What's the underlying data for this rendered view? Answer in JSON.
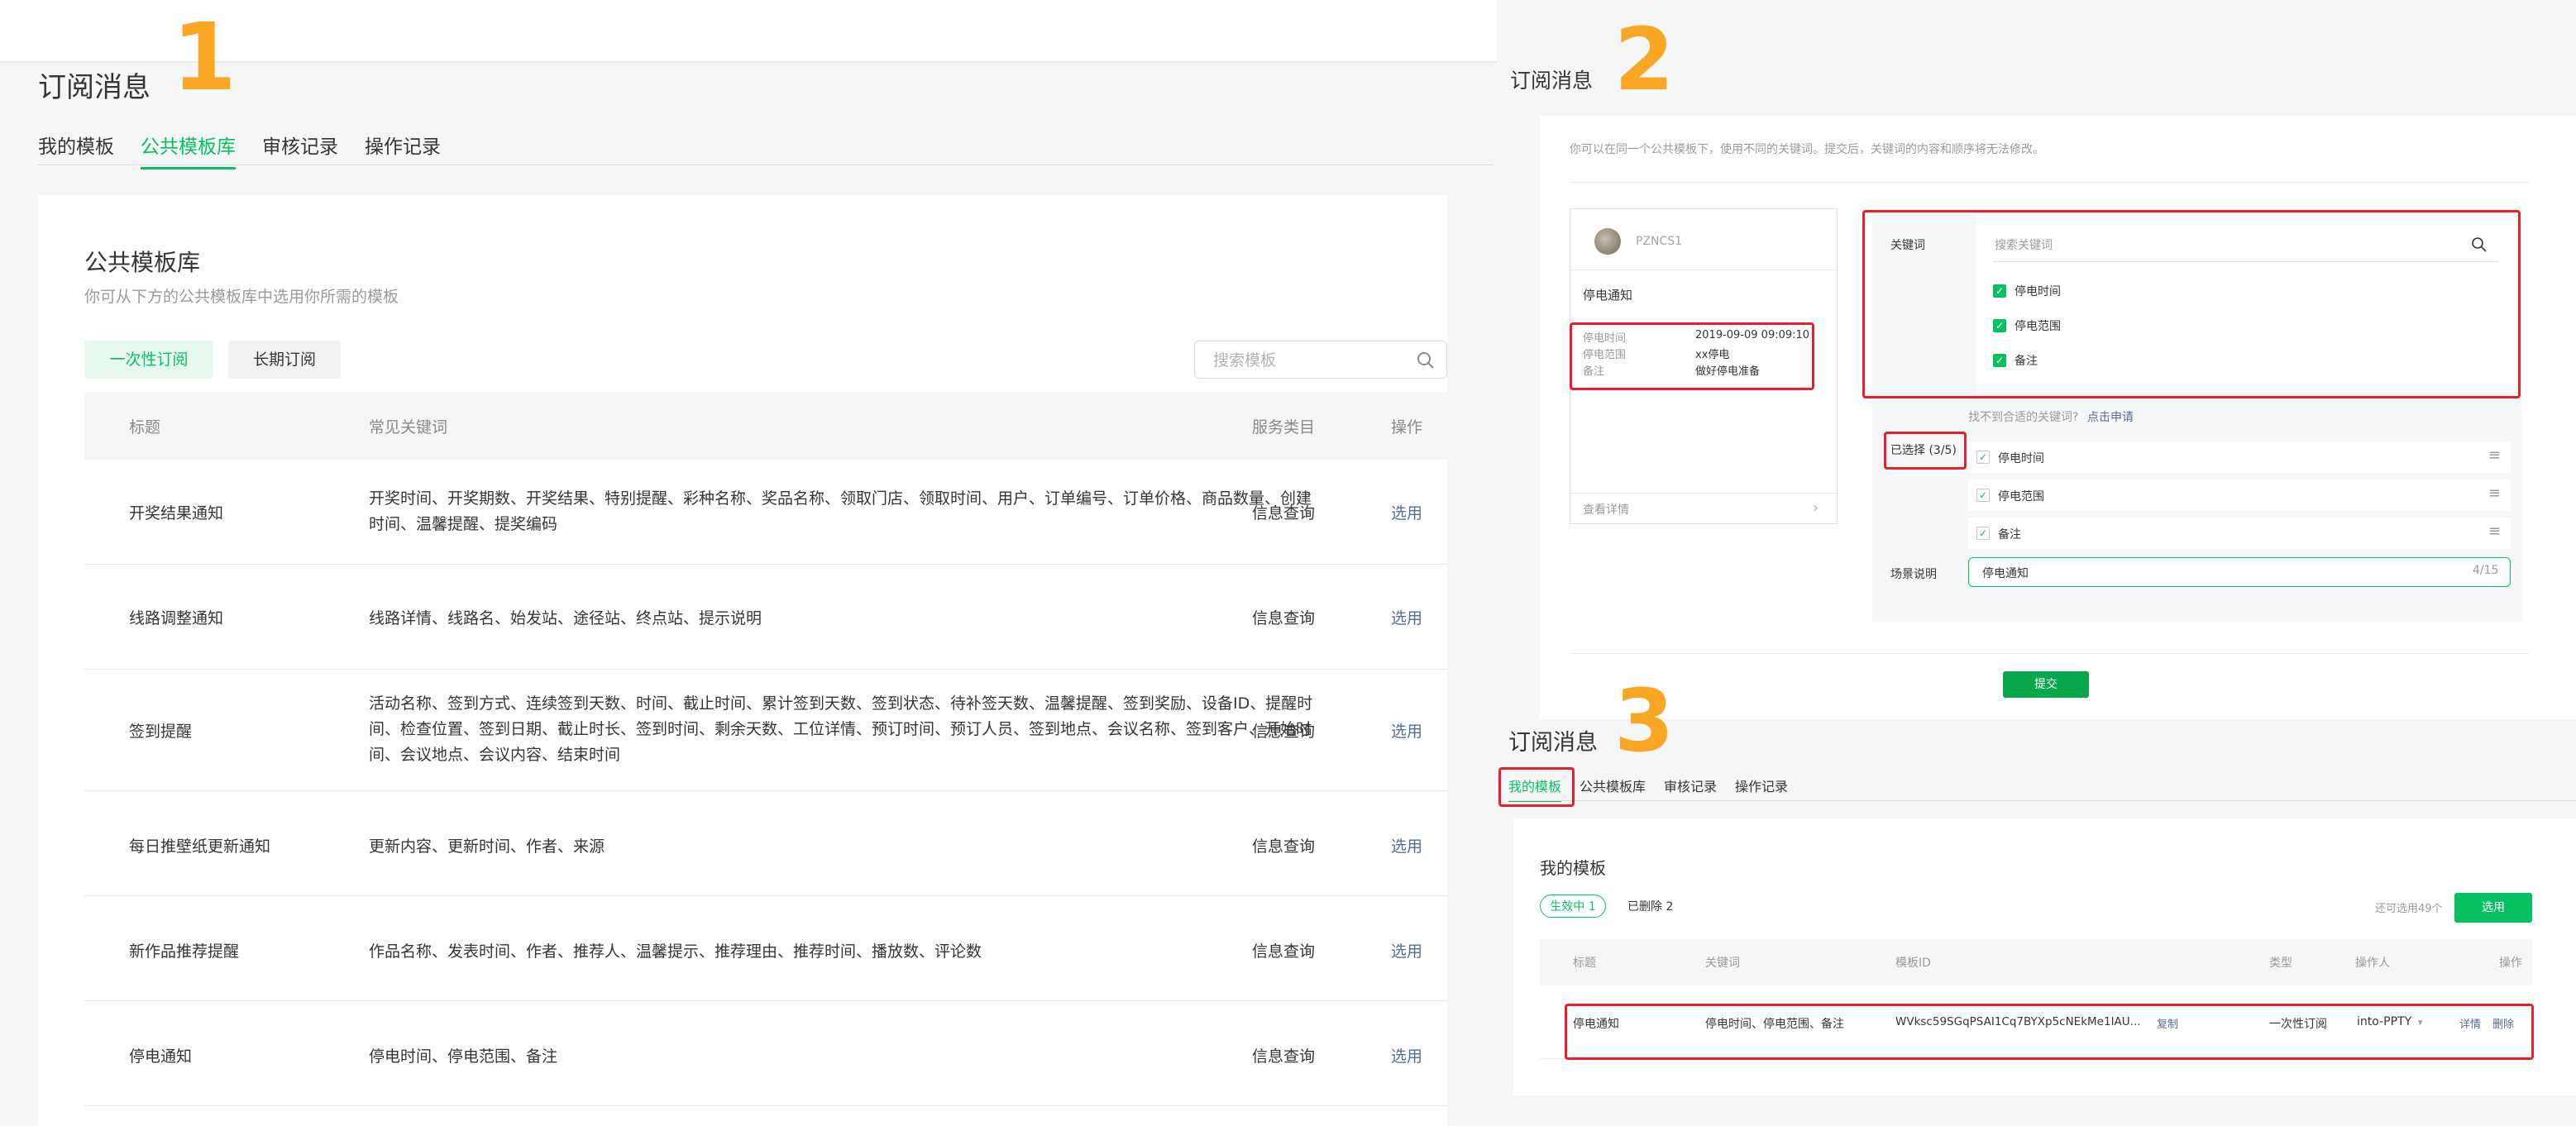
{
  "markers": [
    "1",
    "2",
    "3"
  ],
  "panel1": {
    "title": "订阅消息",
    "tabs": [
      "我的模板",
      "公共模板库",
      "审核记录",
      "操作记录"
    ],
    "library_title": "公共模板库",
    "library_subtitle": "你可从下方的公共模板库中选用你所需的模板",
    "filters": [
      "一次性订阅",
      "长期订阅"
    ],
    "search_placeholder": "搜索模板",
    "columns": [
      "标题",
      "常见关键词",
      "服务类目",
      "操作"
    ],
    "rows": [
      {
        "title": "开奖结果通知",
        "keywords": "开奖时间、开奖期数、开奖结果、特别提醒、彩种名称、奖品名称、领取门店、领取时间、用户、订单编号、订单价格、商品数量、创建时间、温馨提醒、提奖编码",
        "category": "信息查询",
        "action": "选用"
      },
      {
        "title": "线路调整通知",
        "keywords": "线路详情、线路名、始发站、途径站、终点站、提示说明",
        "category": "信息查询",
        "action": "选用"
      },
      {
        "title": "签到提醒",
        "keywords": "活动名称、签到方式、连续签到天数、时间、截止时间、累计签到天数、签到状态、待补签天数、温馨提醒、签到奖励、设备ID、提醒时间、检查位置、签到日期、截止时长、签到时间、剩余天数、工位详情、预订时间、预订人员、签到地点、会议名称、签到客户、开始时间、会议地点、会议内容、结束时间",
        "category": "信息查询",
        "action": "选用"
      },
      {
        "title": "每日推壁纸更新通知",
        "keywords": "更新内容、更新时间、作者、来源",
        "category": "信息查询",
        "action": "选用"
      },
      {
        "title": "新作品推荐提醒",
        "keywords": "作品名称、发表时间、作者、推荐人、温馨提示、推荐理由、推荐时间、播放数、评论数",
        "category": "信息查询",
        "action": "选用"
      },
      {
        "title": "停电通知",
        "keywords": "停电时间、停电范围、备注",
        "category": "信息查询",
        "action": "选用"
      }
    ]
  },
  "panel2": {
    "title": "订阅消息",
    "tip": "你可以在同一个公共模板下，使用不同的关键词。提交后，关键词的内容和顺序将无法修改。",
    "preview": {
      "account": "PZNCS1",
      "template_name": "停电通知",
      "fields": [
        {
          "key": "停电时间",
          "value": "2019-09-09 09:09:10"
        },
        {
          "key": "停电范围",
          "value": "xx停电"
        },
        {
          "key": "备注",
          "value": "做好停电准备"
        }
      ],
      "detail_label": "查看详情"
    },
    "keyword_label": "关键词",
    "keyword_search_placeholder": "搜索关键词",
    "keyword_options": [
      "停电时间",
      "停电范围",
      "备注"
    ],
    "not_found": "找不到合适的关键词?",
    "apply_link": "点击申请",
    "selected_label": "已选择 (3/5)",
    "selected": [
      "停电时间",
      "停电范围",
      "备注"
    ],
    "scene_label": "场景说明",
    "scene_value": "停电通知",
    "scene_count": "4/15",
    "submit": "提交"
  },
  "panel3": {
    "title": "订阅消息",
    "tabs": [
      "我的模板",
      "公共模板库",
      "审核记录",
      "操作记录"
    ],
    "section_title": "我的模板",
    "active_badge": "生效中 1",
    "deleted": "已删除 2",
    "remaining": "还可选用49个",
    "select_button": "选用",
    "columns": [
      "标题",
      "关键词",
      "模板ID",
      "类型",
      "操作人",
      "操作"
    ],
    "row": {
      "title": "停电通知",
      "keywords": "停电时间、停电范围、备注",
      "template_id": "WVksc59SGqPSAI1Cq7BYXp5cNEkMe1IAU...",
      "copy": "复制",
      "type": "一次性订阅",
      "operator": "into-PPTY",
      "detail": "详情",
      "delete": "删除"
    }
  },
  "colors": {
    "brand_green": "#07C160",
    "link_blue": "#576B95",
    "marker_orange": "#F8A623",
    "highlight_red": "#e8202b"
  }
}
